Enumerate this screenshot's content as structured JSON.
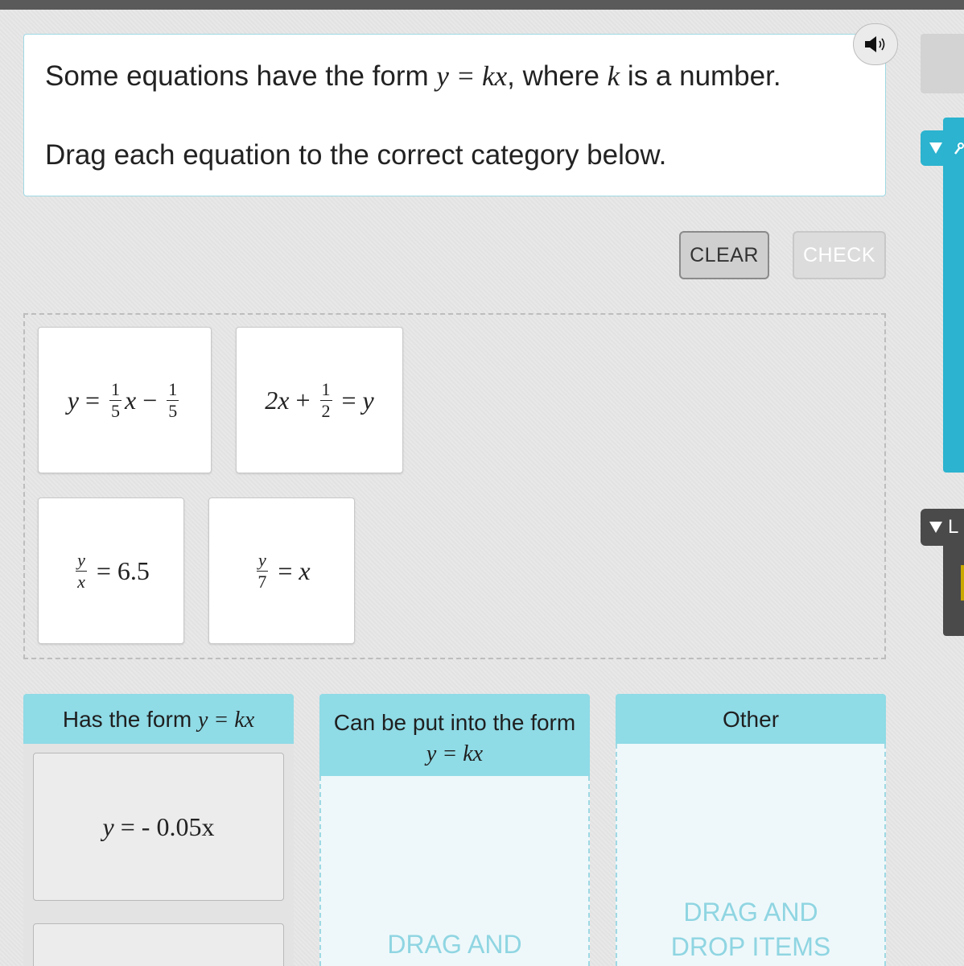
{
  "prompt": {
    "line1_prefix": "Some equations have the form ",
    "line1_math": "y = kx",
    "line1_mid": ", where ",
    "line1_k": "k",
    "line1_suffix": " is a number.",
    "line2": "Drag each equation to the correct category below."
  },
  "buttons": {
    "clear": "CLEAR",
    "check": "CHECK"
  },
  "side_panel": {
    "dark_tab_letter": "L"
  },
  "cards": [
    {
      "lhs": "y",
      "eq": "=",
      "f1_num": "1",
      "f1_den": "5",
      "mid": "x",
      "minus": "−",
      "f2_num": "1",
      "f2_den": "5"
    },
    {
      "a": "2x",
      "plus": "+",
      "f_num": "1",
      "f_den": "2",
      "eq": "=",
      "rhs": "y"
    },
    {
      "f_num": "y",
      "f_den": "x",
      "eq": "=",
      "rhs": "6.5"
    },
    {
      "f_num": "y",
      "f_den": "7",
      "eq": "=",
      "rhs": "x"
    }
  ],
  "categories": [
    {
      "title": "Has the form ",
      "math": "y = kx"
    },
    {
      "title": "Can be put into the form",
      "math": "y = kx",
      "hint": "DRAG AND"
    },
    {
      "title": "Other",
      "hint": "DRAG AND\nDROP ITEMS"
    }
  ],
  "placed": [
    {
      "lhs": "y",
      "eq": "=",
      "rhs": "- 0.05x"
    }
  ],
  "colors": {
    "accent": "#2bb3cf",
    "category_header": "#8fdbe6",
    "hint_text": "#8fd5e2"
  }
}
